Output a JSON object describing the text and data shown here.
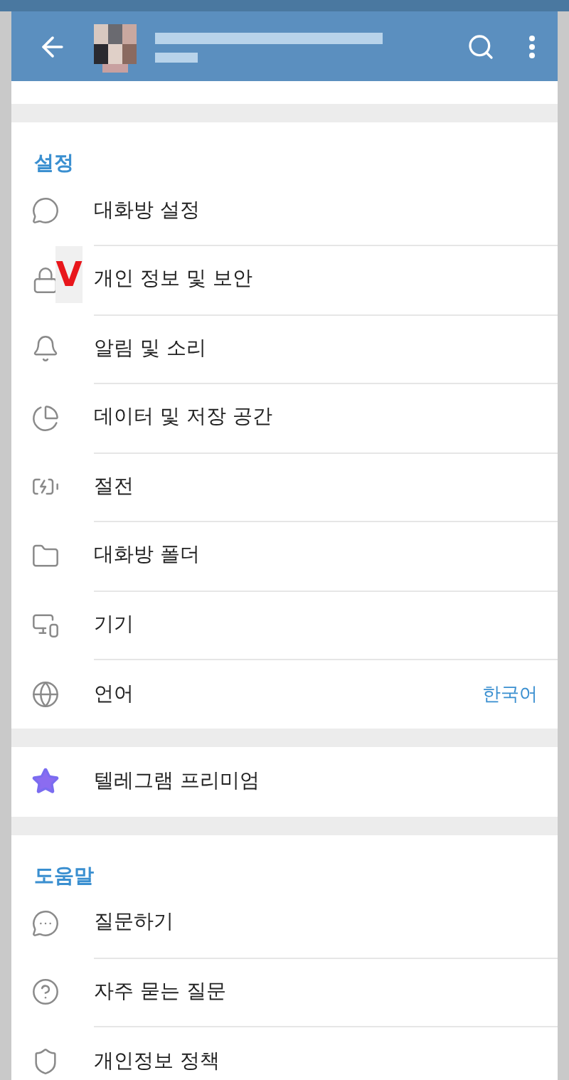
{
  "header": {
    "kind": "profile"
  },
  "settings": {
    "title": "설정",
    "items": [
      {
        "label": "대화방 설정"
      },
      {
        "label": "개인 정보 및 보안",
        "mark": "V"
      },
      {
        "label": "알림 및 소리"
      },
      {
        "label": "데이터 및 저장 공간"
      },
      {
        "label": "절전"
      },
      {
        "label": "대화방 폴더"
      },
      {
        "label": "기기"
      },
      {
        "label": "언어",
        "value": "한국어"
      }
    ]
  },
  "premium": {
    "label": "텔레그램 프리미엄"
  },
  "help": {
    "title": "도움말",
    "items": [
      {
        "label": "질문하기"
      },
      {
        "label": "자주 묻는 질문"
      },
      {
        "label": "개인정보 정책"
      }
    ]
  }
}
